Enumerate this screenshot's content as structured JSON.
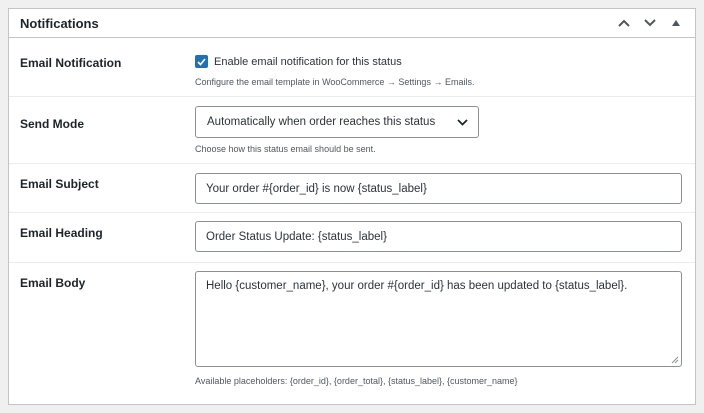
{
  "panel": {
    "title": "Notifications"
  },
  "fields": {
    "email_notification": {
      "label": "Email Notification",
      "checkbox_label": "Enable email notification for this status",
      "checked": true,
      "description": "Configure the email template in WooCommerce → Settings → Emails."
    },
    "send_mode": {
      "label": "Send Mode",
      "selected": "Automatically when order reaches this status",
      "description": "Choose how this status email should be sent."
    },
    "email_subject": {
      "label": "Email Subject",
      "value": "Your order #{order_id} is now {status_label}"
    },
    "email_heading": {
      "label": "Email Heading",
      "value": "Order Status Update: {status_label}"
    },
    "email_body": {
      "label": "Email Body",
      "value": "Hello {customer_name}, your order #{order_id} has been updated to {status_label}.",
      "description": "Available placeholders: {order_id}, {order_total}, {status_label}, {customer_name}"
    }
  },
  "colors": {
    "accent": "#2271b1",
    "border": "#c3c4c7",
    "background": "#f0f0f1"
  }
}
